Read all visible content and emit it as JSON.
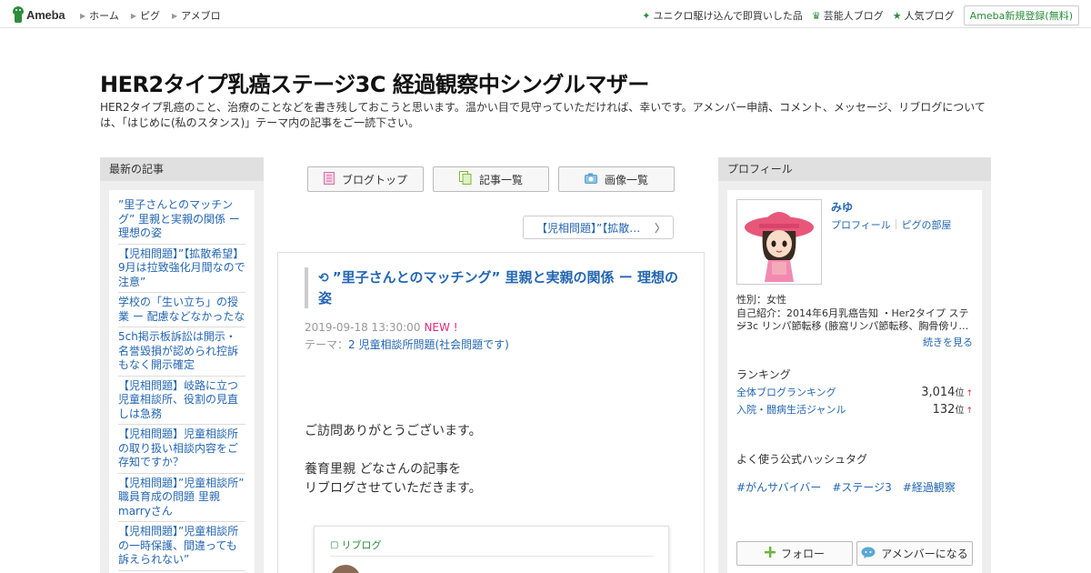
{
  "header": {
    "logo_text": "Ameba",
    "nav": [
      "ホーム",
      "ピグ",
      "アメブロ"
    ],
    "right_links": [
      {
        "icon": "sparkle-icon",
        "label": "ユニクロ駆け込んで即買いした品"
      },
      {
        "icon": "crown-icon",
        "label": "芸能人ブログ"
      },
      {
        "icon": "star-icon",
        "label": "人気ブログ"
      }
    ],
    "register_label": "Ameba新規登録(無料)"
  },
  "blog": {
    "title": "HER2タイプ乳癌ステージ3C 経過観察中シングルマザー",
    "description": "HER2タイプ乳癌のこと、治療のことなどを書き残しておこうと思います。温かい目で見守っていただければ、幸いです。アメンバー申請、コメント、メッセージ、リブログについては、「はじめに(私のスタンス)」テーマ内の記事をご一読下さい。"
  },
  "left": {
    "heading": "最新の記事",
    "recent": [
      "”里子さんとのマッチング” 里親と実親の関係 ー 理想の姿",
      "【児相問題】”【拡散希望】9月は拉致強化月間なので注意”",
      "学校の「生い立ち」の授業 ー 配慮などなかったな",
      "5ch掲示板訴訟は開示・名誉毀損が認められ控訴もなく開示確定",
      "【児相問題】岐路に立つ児童相談所、役割の見直しは急務",
      "【児相問題】児童相談所の取り扱い相談内容をご存知ですか？",
      "【児相問題】”児童相談所” 職員育成の問題 里親marryさん",
      "【児相問題】”児童相談所の一時保護、間違っても訴えられない”"
    ]
  },
  "center": {
    "nav_buttons": [
      {
        "icon": "document-icon",
        "label": "ブログトップ"
      },
      {
        "icon": "list-icon",
        "label": "記事一覧"
      },
      {
        "icon": "camera-icon",
        "label": "画像一覧"
      }
    ],
    "prev_article": "【児相問題】”【拡散…",
    "article": {
      "title": "”里子さんとのマッチング” 里親と実親の関係 ー 理想の姿",
      "date": "2019-09-18 13:30:00",
      "new_badge": "NEW !",
      "theme_prefix": "テーマ：",
      "theme": "2 児童相談所問題(社会問題です)",
      "body_line1": "ご訪問ありがとうございます。",
      "body_line2": "養育里親 どなさんの記事を",
      "body_line3": "リブログさせていただきます。",
      "reblog_label": "リブログ"
    }
  },
  "right": {
    "heading": "プロフィール",
    "name": "みゆ",
    "link_profile": "プロフィール",
    "link_pig": "ピグの部屋",
    "gender": "性別：女性",
    "intro_line1": "自己紹介：2014年6月乳癌告知 ・Her2タイプ ステー",
    "intro_line2": "ジ3c リンパ節転移 (腋窩リンパ節転移、胸骨傍リ…",
    "read_more": "続きを見る",
    "ranking_heading": "ランキング",
    "rankings": [
      {
        "name": "全体ブログランキング",
        "value": "3,014",
        "unit": "位",
        "arrow": "↑"
      },
      {
        "name": "入院・闘病生活ジャンル",
        "value": "132",
        "unit": "位",
        "arrow": "↑"
      }
    ],
    "hashtag_heading": "よく使う公式ハッシュタグ",
    "hashtags": [
      "#がんサバイバー",
      "#ステージ3",
      "#経過観察"
    ],
    "follow_label": "フォロー",
    "amember_label": "アメンバーになる"
  },
  "colors": {
    "ameba_green": "#2d8c3c",
    "link_blue": "#2466b3",
    "new_pink": "#e5267b",
    "sidebar_gray": "#eeeeee"
  }
}
